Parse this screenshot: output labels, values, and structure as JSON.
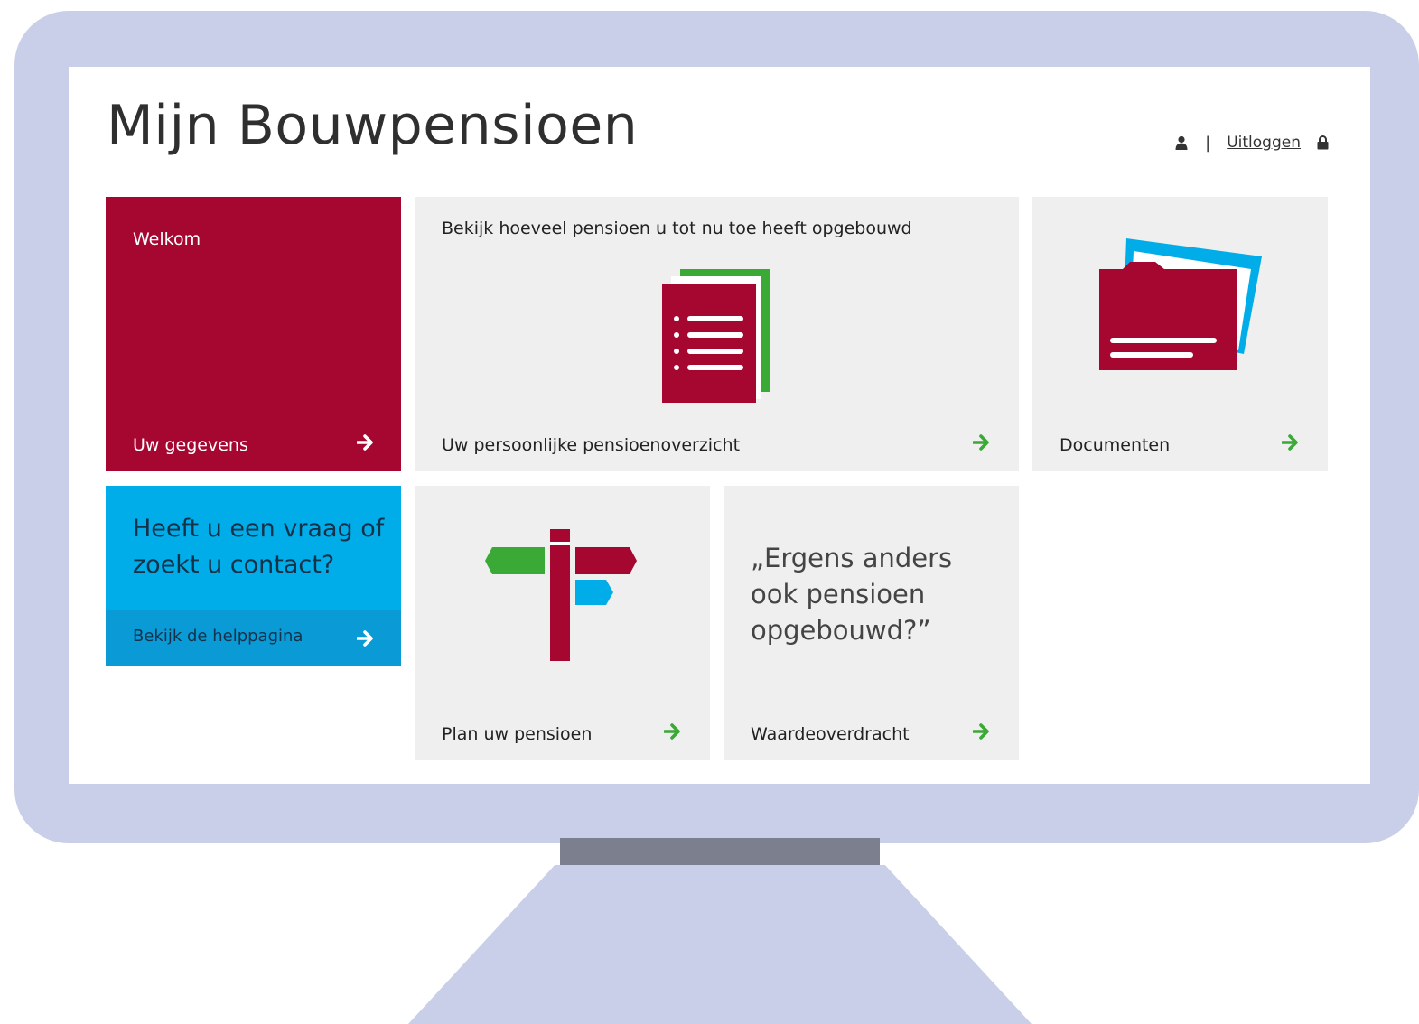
{
  "header": {
    "title": "Mijn Bouwpensioen",
    "separator": "|",
    "logout_label": "Uitloggen"
  },
  "tiles": {
    "welcome": {
      "greeting": "Welkom",
      "link_label": "Uw gegevens"
    },
    "overview": {
      "subtitle": "Bekijk hoeveel pensioen u tot nu toe heeft opgebouwd",
      "link_label": "Uw persoonlijke pensioenoverzicht"
    },
    "documents": {
      "link_label": "Documenten"
    },
    "help": {
      "question": "Heeft u een vraag of zoekt u contact?",
      "link_label": "Bekijk de helppagina"
    },
    "plan": {
      "link_label": "Plan uw pensioen"
    },
    "transfer": {
      "quote": "„Ergens anders ook pensioen opgebouwd?”",
      "link_label": "Waardeoverdracht"
    }
  },
  "colors": {
    "brand_red": "#a50731",
    "brand_blue": "#00ade9",
    "accent_green": "#3aa935",
    "tile_grey": "#efefef"
  },
  "icons": [
    "user-icon",
    "lock-icon",
    "arrow-right-icon",
    "document-list-icon",
    "folder-icon",
    "signpost-icon"
  ]
}
